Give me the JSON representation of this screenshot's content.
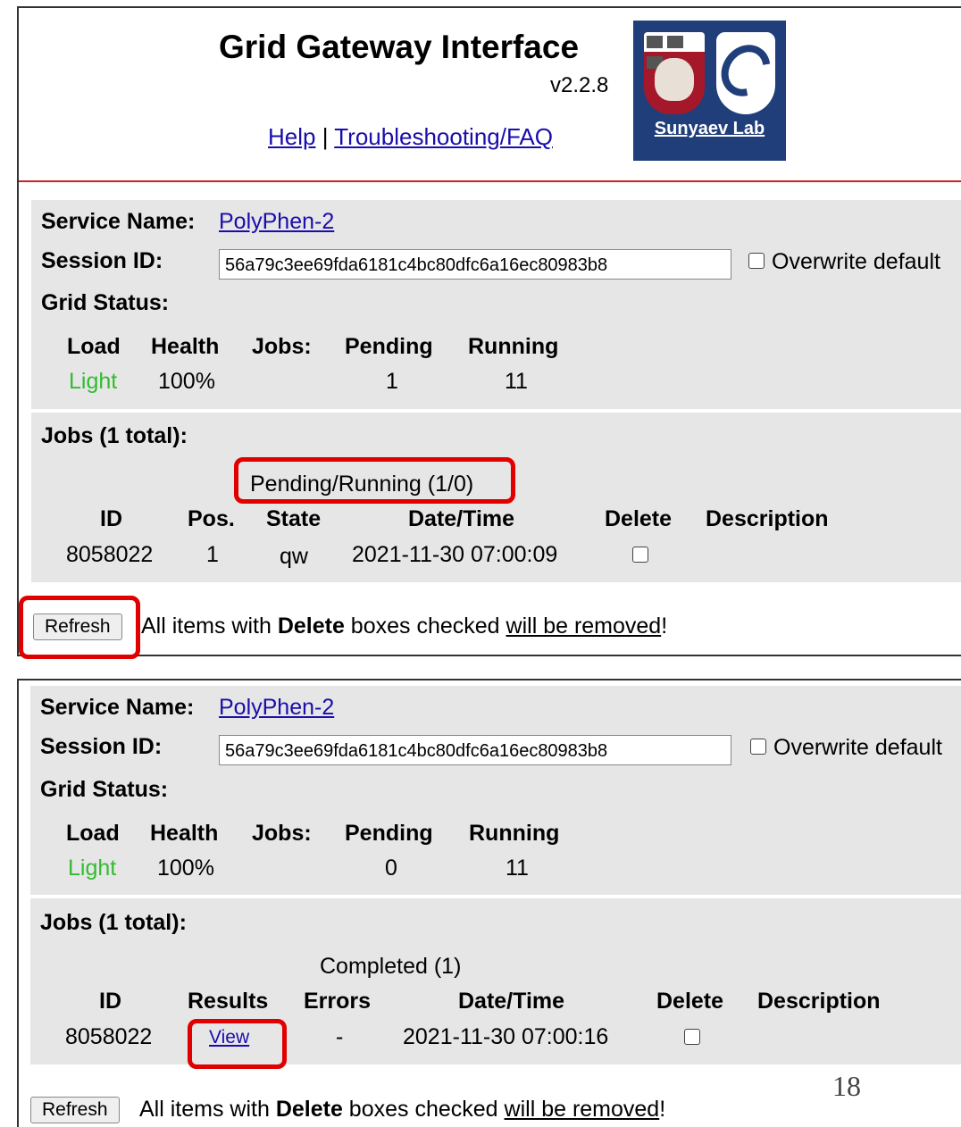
{
  "header": {
    "title": "Grid Gateway Interface",
    "version": "v2.2.8",
    "help_link": "Help",
    "separator": "|",
    "faq_link": "Troubleshooting/FAQ",
    "logo_label": "Sunyaev Lab"
  },
  "panels": [
    {
      "service_name_label": "Service Name:",
      "service_name": "PolyPhen-2",
      "session_id_label": "Session ID:",
      "session_id": "56a79c3ee69fda6181c4bc80dfc6a16ec80983b8",
      "overwrite_label": "Overwrite default",
      "grid_status_label": "Grid Status:",
      "grid_headers": [
        "Load",
        "Health",
        "Jobs:",
        "Pending",
        "Running"
      ],
      "grid_values": {
        "load": "Light",
        "health": "100%",
        "pending": "1",
        "running": "11"
      },
      "jobs_label": "Jobs (1 total):",
      "group_title": "Pending/Running (1/0)",
      "job_headers": [
        "ID",
        "Pos.",
        "State",
        "Date/Time",
        "Delete",
        "Description"
      ],
      "job_row": {
        "id": "8058022",
        "pos": "1",
        "state": "qw",
        "datetime": "2021-11-30 07:00:09"
      },
      "refresh_label": "Refresh",
      "notice_pre": "All items with ",
      "notice_bold": "Delete",
      "notice_mid": " boxes checked ",
      "notice_link": "will be removed",
      "notice_end": "!"
    },
    {
      "service_name_label": "Service Name:",
      "service_name": "PolyPhen-2",
      "session_id_label": "Session ID:",
      "session_id": "56a79c3ee69fda6181c4bc80dfc6a16ec80983b8",
      "overwrite_label": "Overwrite default",
      "grid_status_label": "Grid Status:",
      "grid_headers": [
        "Load",
        "Health",
        "Jobs:",
        "Pending",
        "Running"
      ],
      "grid_values": {
        "load": "Light",
        "health": "100%",
        "pending": "0",
        "running": "11"
      },
      "jobs_label": "Jobs (1 total):",
      "group_title": "Completed (1)",
      "job_headers": [
        "ID",
        "Results",
        "Errors",
        "Date/Time",
        "Delete",
        "Description"
      ],
      "job_row": {
        "id": "8058022",
        "results": "View",
        "errors": "-",
        "datetime": "2021-11-30 07:00:16"
      },
      "refresh_label": "Refresh",
      "notice_pre": "All items with ",
      "notice_bold": "Delete",
      "notice_mid": " boxes checked ",
      "notice_link": "will be removed",
      "notice_end": "!"
    }
  ],
  "page_number": "18",
  "colors": {
    "highlight": "#e00000",
    "link": "#1a0dab",
    "light_status": "#33bb33",
    "logo_bg": "#1f3e7a"
  }
}
